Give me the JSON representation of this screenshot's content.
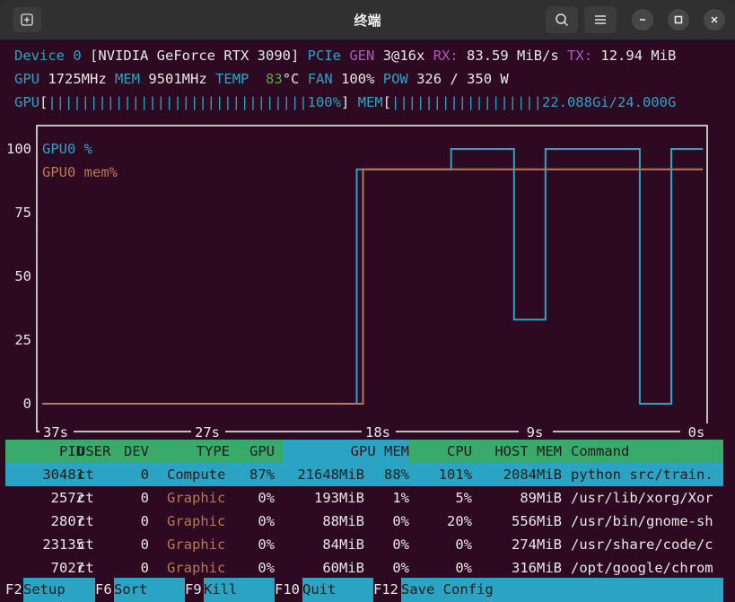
{
  "window": {
    "title": "终端"
  },
  "device": {
    "label": "Device",
    "index": "0",
    "name": "[NVIDIA GeForce RTX 3090]",
    "pcie_label": "PCIe",
    "gen_label": "GEN",
    "gen_value": "3@16x",
    "rx_label": "RX:",
    "rx_value": "83.59 MiB/s",
    "tx_label": "TX:",
    "tx_value": "12.94 MiB"
  },
  "stats": {
    "gpu_label": "GPU",
    "gpu_clock": "1725MHz",
    "mem_label": "MEM",
    "mem_clock": "9501MHz",
    "temp_label": "TEMP",
    "temp_value": "83",
    "temp_unit": "°C",
    "fan_label": "FAN",
    "fan_value": "100%",
    "pow_label": "POW",
    "pow_value": "326 / 350 W"
  },
  "bars": {
    "gpu_label": "GPU",
    "gpu_open": "[",
    "gpu_fill": "|||||||||||||||||||||||||||||||",
    "gpu_value": "100%",
    "gpu_close": "]",
    "mem_label": "MEM",
    "mem_open": "[",
    "mem_fill": "||||||||||||||||||",
    "mem_value": "22.088Gi/24.000G"
  },
  "chart_data": {
    "type": "line",
    "y_ticks": [
      "100",
      "75",
      "50",
      "25",
      "0"
    ],
    "ylim": [
      0,
      100
    ],
    "x_ticks": [
      "37s",
      "27s",
      "18s",
      "9s",
      "0s"
    ],
    "xlim": [
      -40,
      0
    ],
    "series": [
      {
        "name": "GPU0 %",
        "color": "#2ba4c4",
        "points": [
          [
            -40,
            0
          ],
          [
            -20,
            0
          ],
          [
            -20,
            92
          ],
          [
            -14,
            92
          ],
          [
            -14,
            100
          ],
          [
            -10,
            100
          ],
          [
            -10,
            33
          ],
          [
            -8,
            33
          ],
          [
            -8,
            100
          ],
          [
            -2,
            100
          ],
          [
            -2,
            0
          ],
          [
            0,
            0
          ],
          [
            0,
            100
          ],
          [
            2,
            100
          ]
        ]
      },
      {
        "name": "GPU0 mem%",
        "color": "#b87a52",
        "points": [
          [
            -40,
            0
          ],
          [
            -19.6,
            0
          ],
          [
            -19.6,
            92
          ],
          [
            2,
            92
          ]
        ]
      }
    ]
  },
  "process_table": {
    "headers": [
      "PID",
      "USER",
      "DEV",
      "TYPE",
      "GPU",
      "GPU MEM",
      "CPU",
      "HOST MEM",
      "Command"
    ],
    "rows": [
      {
        "pid": "30481",
        "user": "ct",
        "dev": "0",
        "type": "Compute",
        "gpu": "87%",
        "gpu_mem": "21648MiB",
        "gpu_mem_pct": "88%",
        "cpu": "101%",
        "host_mem": "2084MiB",
        "command": "python src/train."
      },
      {
        "pid": "2572",
        "user": "ct",
        "dev": "0",
        "type": "Graphic",
        "gpu": "0%",
        "gpu_mem": "193MiB",
        "gpu_mem_pct": "1%",
        "cpu": "5%",
        "host_mem": "89MiB",
        "command": "/usr/lib/xorg/Xor"
      },
      {
        "pid": "2807",
        "user": "ct",
        "dev": "0",
        "type": "Graphic",
        "gpu": "0%",
        "gpu_mem": "88MiB",
        "gpu_mem_pct": "0%",
        "cpu": "20%",
        "host_mem": "556MiB",
        "command": "/usr/bin/gnome-sh"
      },
      {
        "pid": "23135",
        "user": "ct",
        "dev": "0",
        "type": "Graphic",
        "gpu": "0%",
        "gpu_mem": "84MiB",
        "gpu_mem_pct": "0%",
        "cpu": "0%",
        "host_mem": "274MiB",
        "command": "/usr/share/code/c"
      },
      {
        "pid": "7027",
        "user": "ct",
        "dev": "0",
        "type": "Graphic",
        "gpu": "0%",
        "gpu_mem": "60MiB",
        "gpu_mem_pct": "0%",
        "cpu": "0%",
        "host_mem": "316MiB",
        "command": "/opt/google/chrom"
      }
    ]
  },
  "function_keys": [
    {
      "key": "F2",
      "label": "Setup"
    },
    {
      "key": "F6",
      "label": "Sort"
    },
    {
      "key": "F9",
      "label": "Kill"
    },
    {
      "key": "F10",
      "label": "Quit"
    },
    {
      "key": "F12",
      "label": "Save Config"
    }
  ],
  "colors": {
    "terminal_bg": "#2d0922",
    "accent_blue": "#2ba4c4",
    "accent_green": "#3aaa6a",
    "accent_orange": "#b87a52",
    "accent_purple": "#a85fb5"
  },
  "icons": [
    "new-tab-icon",
    "search-icon",
    "menu-icon",
    "minimize-icon",
    "maximize-icon",
    "close-icon"
  ]
}
